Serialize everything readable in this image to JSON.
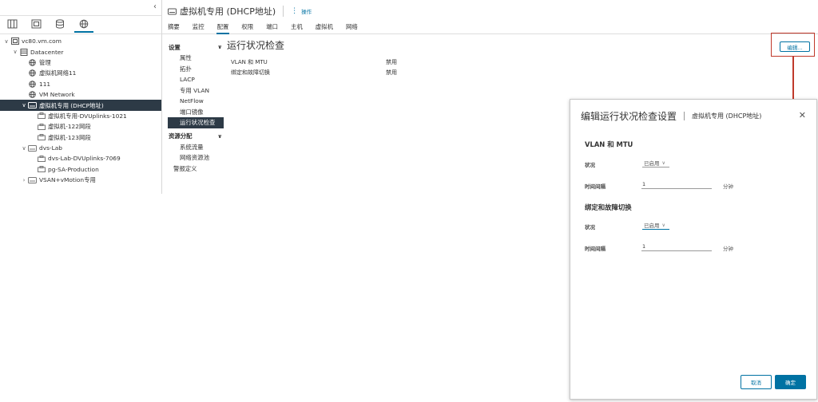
{
  "navigator": {
    "collapse_icon": "chevron-left-icon",
    "tabs": [
      {
        "icon": "hosts-clusters-icon",
        "active": false
      },
      {
        "icon": "vms-templates-icon",
        "active": false
      },
      {
        "icon": "storage-icon",
        "active": false
      },
      {
        "icon": "networking-icon",
        "active": true
      }
    ],
    "tree": [
      {
        "label": "vc80.vm.com",
        "indent": 0,
        "caret": "∨",
        "icon": "vcenter-icon"
      },
      {
        "label": "Datacenter",
        "indent": 1,
        "caret": "∨",
        "icon": "datacenter-icon"
      },
      {
        "label": "管理",
        "indent": 2,
        "caret": "",
        "icon": "network-icon"
      },
      {
        "label": "虚拟机网络11",
        "indent": 2,
        "caret": "",
        "icon": "network-icon"
      },
      {
        "label": "111",
        "indent": 2,
        "caret": "",
        "icon": "network-icon"
      },
      {
        "label": "VM Network",
        "indent": 2,
        "caret": "",
        "icon": "network-icon"
      },
      {
        "label": "虚拟机专用 (DHCP地址)",
        "indent": 2,
        "caret": "∨",
        "icon": "dvswitch-icon",
        "selected": true
      },
      {
        "label": "虚拟机专用-DVUplinks-1021",
        "indent": 3,
        "caret": "",
        "icon": "portgroup-icon"
      },
      {
        "label": "虚拟机-122网段",
        "indent": 3,
        "caret": "",
        "icon": "portgroup-icon"
      },
      {
        "label": "虚拟机-123网段",
        "indent": 3,
        "caret": "",
        "icon": "portgroup-icon"
      },
      {
        "label": "dvs-Lab",
        "indent": 2,
        "caret": "∨",
        "icon": "dvswitch-icon"
      },
      {
        "label": "dvs-Lab-DVUplinks-7069",
        "indent": 3,
        "caret": "",
        "icon": "portgroup-icon"
      },
      {
        "label": "pg-SA-Production",
        "indent": 3,
        "caret": "",
        "icon": "portgroup-icon"
      },
      {
        "label": "VSAN+vMotion专用",
        "indent": 2,
        "caret": "›",
        "icon": "dvswitch-icon"
      }
    ]
  },
  "header": {
    "title": "虚拟机专用 (DHCP地址)",
    "actions_label": "操作"
  },
  "tabs": [
    {
      "label": "摘要",
      "active": false
    },
    {
      "label": "监控",
      "active": false
    },
    {
      "label": "配置",
      "active": true
    },
    {
      "label": "权限",
      "active": false
    },
    {
      "label": "端口",
      "active": false
    },
    {
      "label": "主机",
      "active": false
    },
    {
      "label": "虚拟机",
      "active": false
    },
    {
      "label": "网络",
      "active": false
    }
  ],
  "config_menu": {
    "group1": "设置",
    "group1_items": [
      {
        "label": "属性"
      },
      {
        "label": "拓扑"
      },
      {
        "label": "LACP"
      },
      {
        "label": "专用 VLAN"
      },
      {
        "label": "NetFlow"
      },
      {
        "label": "端口镜像"
      },
      {
        "label": "运行状况检查",
        "active": true
      }
    ],
    "group2": "资源分配",
    "group2_items": [
      {
        "label": "系统流量"
      },
      {
        "label": "网络资源池"
      }
    ],
    "plain_item": "警报定义"
  },
  "content": {
    "title": "运行状况检查",
    "edit_label": "编辑...",
    "rows": [
      {
        "key": "VLAN 和 MTU",
        "value": "禁用"
      },
      {
        "key": "绑定和故障切换",
        "value": "禁用"
      }
    ]
  },
  "modal": {
    "title": "编辑运行状况检查设置",
    "subtitle": "虚拟机专用 (DHCP地址)",
    "section1": {
      "title": "VLAN 和 MTU",
      "status_label": "状况",
      "status_value": "已启用",
      "interval_label": "时间间隔",
      "interval_value": "1",
      "interval_unit": "分钟"
    },
    "section2": {
      "title": "绑定和故障切换",
      "status_label": "状况",
      "status_value": "已启用",
      "interval_label": "时间间隔",
      "interval_value": "1",
      "interval_unit": "分钟"
    },
    "cancel_label": "取消",
    "ok_label": "确定"
  },
  "colors": {
    "accent": "#0072a3",
    "selected_bg": "#2d3a46",
    "callout": "#c0392b"
  }
}
